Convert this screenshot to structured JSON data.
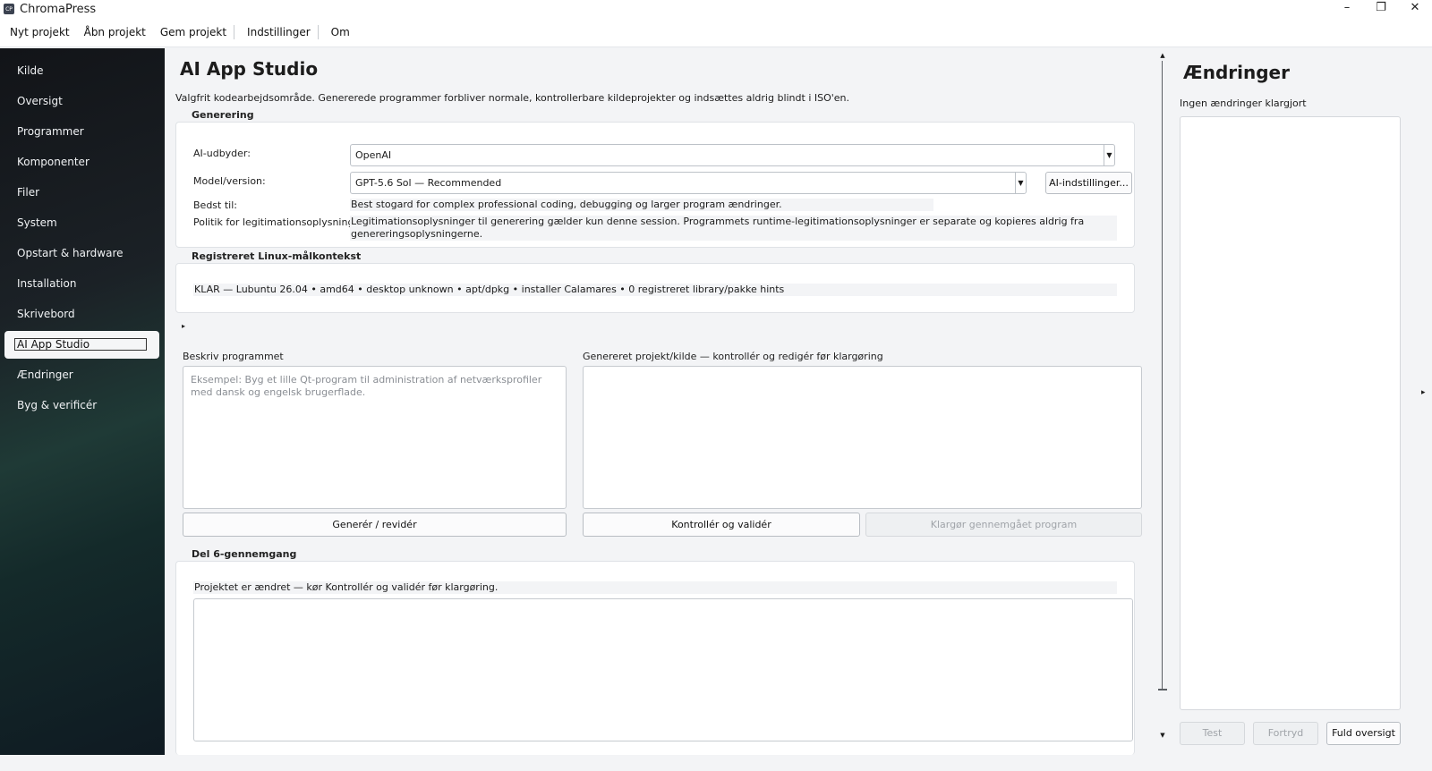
{
  "window": {
    "app_icon_text": "CP",
    "title": "ChromaPress",
    "minimize": "–",
    "maximize": "❐",
    "close": "✕"
  },
  "menu": [
    "Nyt projekt",
    "Åbn projekt",
    "Gem projekt",
    "Indstillinger",
    "Om"
  ],
  "sidebar": {
    "items": [
      "Kilde",
      "Oversigt",
      "Programmer",
      "Komponenter",
      "Filer",
      "System",
      "Opstart & hardware",
      "Installation",
      "Skrivebord",
      "AI App Studio",
      "Ændringer",
      "Byg & verificér"
    ],
    "active": "AI App Studio"
  },
  "main": {
    "title": "AI App Studio",
    "intro": "Valgfrit kodearbejdsområde. Genererede programmer forbliver normale, kontrollerbare kildeprojekter og indsættes aldrig blindt i ISO'en.",
    "generation": {
      "section": "Generering",
      "provider_label": "AI-udbyder:",
      "provider_value": "OpenAI",
      "model_label": "Model/version:",
      "model_value": "GPT-5.6 Sol — Recommended",
      "ai_settings_button": "AI-indstillinger...",
      "best_for_label": "Bedst til:",
      "best_for_value": "Best stogard for complex professional coding, debugging og larger program ændringer.",
      "policy_label": "Politik for legitimationsoplysninger:",
      "policy_value": "Legitimationsoplysninger til generering gælder kun denne session. Programmets runtime-legitimationsoplysninger er separate og kopieres aldrig fra genereringsoplysningerne."
    },
    "linux_context": {
      "section": "Registreret Linux-målkontekst",
      "value": "KLAR — Lubuntu 26.04 • amd64 • desktop unknown • apt/dpkg • installer Calamares • 0 registreret library/pakke hints"
    },
    "expander": "▸",
    "describe": {
      "label": "Beskriv programmet",
      "placeholder": "Eksempel: Byg et lille Qt-program til administration af netværksprofiler med dansk og engelsk brugerflade.",
      "generate_button": "Generér / revidér"
    },
    "generated": {
      "label": "Genereret projekt/kilde — kontrollér og redigér før klargøring",
      "check_button": "Kontrollér og validér",
      "prepare_button": "Klargør gennemgået program"
    },
    "review": {
      "section": "Del 6-gennemgang",
      "status": "Projektet er ændret — kør Kontrollér og validér før klargøring."
    }
  },
  "changes": {
    "title": "Ændringer",
    "subtitle": "Ingen ændringer klargjort",
    "buttons": {
      "test": "Test",
      "undo": "Fortryd",
      "full": "Fuld oversigt"
    },
    "collapse_arrow": "▸"
  }
}
